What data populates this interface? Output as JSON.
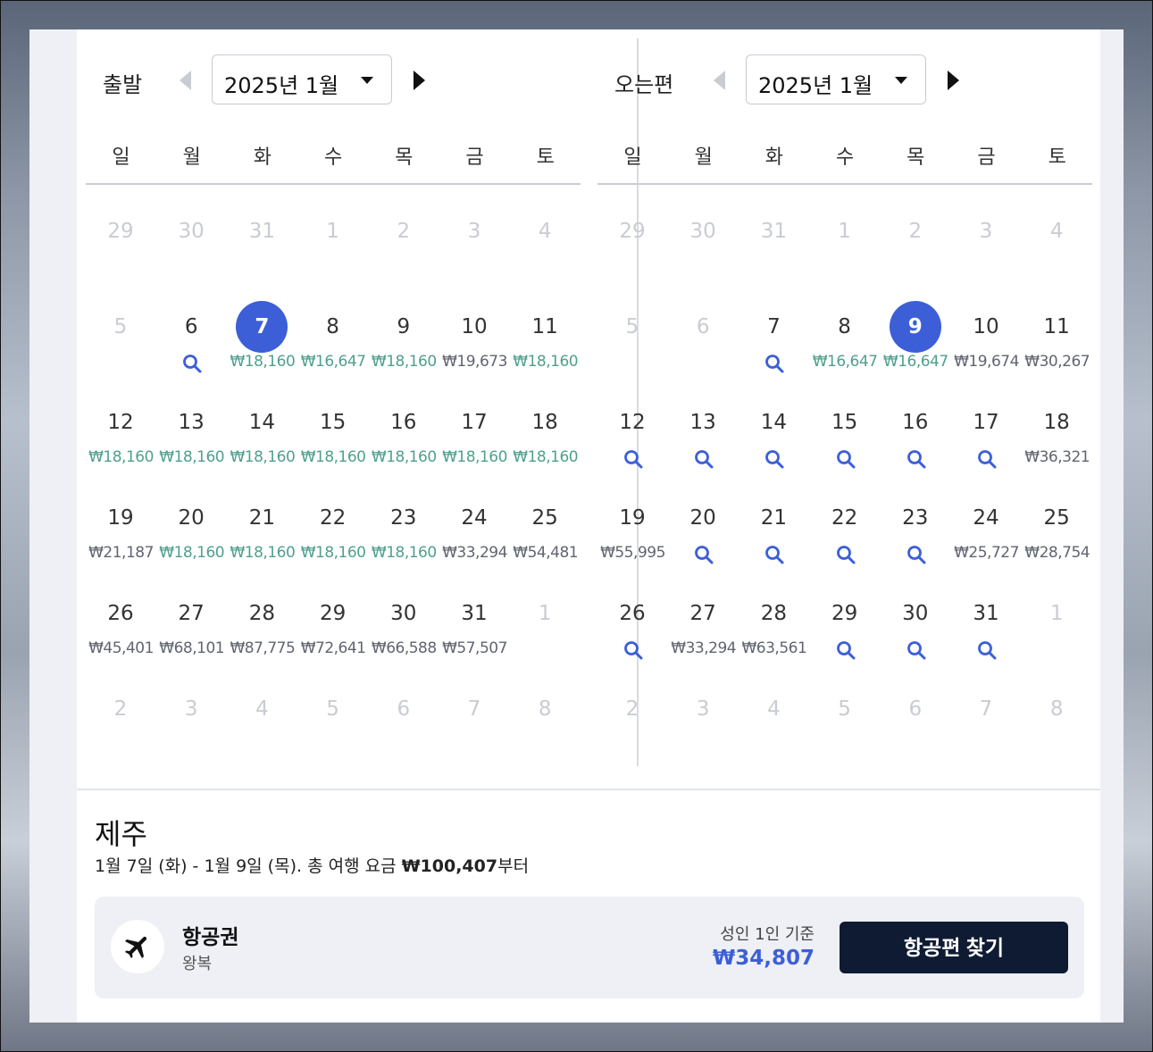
{
  "departure": {
    "label": "출발",
    "month": "2025년 1월",
    "weekdays": [
      "일",
      "월",
      "화",
      "수",
      "목",
      "금",
      "토"
    ],
    "days": [
      {
        "n": "29",
        "muted": true
      },
      {
        "n": "30",
        "muted": true
      },
      {
        "n": "31",
        "muted": true
      },
      {
        "n": "1",
        "muted": true
      },
      {
        "n": "2",
        "muted": true
      },
      {
        "n": "3",
        "muted": true
      },
      {
        "n": "4",
        "muted": true
      },
      {
        "n": "5",
        "muted": true
      },
      {
        "n": "6",
        "search": true
      },
      {
        "n": "7",
        "price": "₩18,160",
        "cheap": true,
        "selected": true
      },
      {
        "n": "8",
        "price": "₩16,647",
        "cheap": true
      },
      {
        "n": "9",
        "price": "₩18,160",
        "cheap": true
      },
      {
        "n": "10",
        "price": "₩19,673",
        "cheap": false
      },
      {
        "n": "11",
        "price": "₩18,160",
        "cheap": true
      },
      {
        "n": "12",
        "price": "₩18,160",
        "cheap": true
      },
      {
        "n": "13",
        "price": "₩18,160",
        "cheap": true
      },
      {
        "n": "14",
        "price": "₩18,160",
        "cheap": true
      },
      {
        "n": "15",
        "price": "₩18,160",
        "cheap": true
      },
      {
        "n": "16",
        "price": "₩18,160",
        "cheap": true
      },
      {
        "n": "17",
        "price": "₩18,160",
        "cheap": true
      },
      {
        "n": "18",
        "price": "₩18,160",
        "cheap": true
      },
      {
        "n": "19",
        "price": "₩21,187",
        "cheap": false
      },
      {
        "n": "20",
        "price": "₩18,160",
        "cheap": true
      },
      {
        "n": "21",
        "price": "₩18,160",
        "cheap": true
      },
      {
        "n": "22",
        "price": "₩18,160",
        "cheap": true
      },
      {
        "n": "23",
        "price": "₩18,160",
        "cheap": true
      },
      {
        "n": "24",
        "price": "₩33,294",
        "cheap": false
      },
      {
        "n": "25",
        "price": "₩54,481",
        "cheap": false
      },
      {
        "n": "26",
        "price": "₩45,401",
        "cheap": false
      },
      {
        "n": "27",
        "price": "₩68,101",
        "cheap": false
      },
      {
        "n": "28",
        "price": "₩87,775",
        "cheap": false
      },
      {
        "n": "29",
        "price": "₩72,641",
        "cheap": false
      },
      {
        "n": "30",
        "price": "₩66,588",
        "cheap": false
      },
      {
        "n": "31",
        "price": "₩57,507",
        "cheap": false
      },
      {
        "n": "1",
        "muted": true
      },
      {
        "n": "2",
        "muted": true
      },
      {
        "n": "3",
        "muted": true
      },
      {
        "n": "4",
        "muted": true
      },
      {
        "n": "5",
        "muted": true
      },
      {
        "n": "6",
        "muted": true
      },
      {
        "n": "7",
        "muted": true
      },
      {
        "n": "8",
        "muted": true
      }
    ]
  },
  "return": {
    "label": "오는편",
    "month": "2025년 1월",
    "weekdays": [
      "일",
      "월",
      "화",
      "수",
      "목",
      "금",
      "토"
    ],
    "days": [
      {
        "n": "29",
        "muted": true
      },
      {
        "n": "30",
        "muted": true
      },
      {
        "n": "31",
        "muted": true
      },
      {
        "n": "1",
        "muted": true
      },
      {
        "n": "2",
        "muted": true
      },
      {
        "n": "3",
        "muted": true
      },
      {
        "n": "4",
        "muted": true
      },
      {
        "n": "5",
        "muted": true
      },
      {
        "n": "6",
        "muted": true
      },
      {
        "n": "7",
        "search": true
      },
      {
        "n": "8",
        "price": "₩16,647",
        "cheap": true
      },
      {
        "n": "9",
        "price": "₩16,647",
        "cheap": true,
        "selected": true
      },
      {
        "n": "10",
        "price": "₩19,674",
        "cheap": false
      },
      {
        "n": "11",
        "price": "₩30,267",
        "cheap": false
      },
      {
        "n": "12",
        "search": true
      },
      {
        "n": "13",
        "search": true
      },
      {
        "n": "14",
        "search": true
      },
      {
        "n": "15",
        "search": true
      },
      {
        "n": "16",
        "search": true
      },
      {
        "n": "17",
        "search": true
      },
      {
        "n": "18",
        "price": "₩36,321",
        "cheap": false
      },
      {
        "n": "19",
        "price": "₩55,995",
        "cheap": false
      },
      {
        "n": "20",
        "search": true
      },
      {
        "n": "21",
        "search": true
      },
      {
        "n": "22",
        "search": true
      },
      {
        "n": "23",
        "search": true
      },
      {
        "n": "24",
        "price": "₩25,727",
        "cheap": false
      },
      {
        "n": "25",
        "price": "₩28,754",
        "cheap": false
      },
      {
        "n": "26",
        "search": true
      },
      {
        "n": "27",
        "price": "₩33,294",
        "cheap": false
      },
      {
        "n": "28",
        "price": "₩63,561",
        "cheap": false
      },
      {
        "n": "29",
        "search": true
      },
      {
        "n": "30",
        "search": true
      },
      {
        "n": "31",
        "search": true
      },
      {
        "n": "1",
        "muted": true
      },
      {
        "n": "2",
        "muted": true
      },
      {
        "n": "3",
        "muted": true
      },
      {
        "n": "4",
        "muted": true
      },
      {
        "n": "5",
        "muted": true
      },
      {
        "n": "6",
        "muted": true
      },
      {
        "n": "7",
        "muted": true
      },
      {
        "n": "8",
        "muted": true
      }
    ]
  },
  "summary": {
    "destination": "제주",
    "dates": "1월 7일 (화) - 1월 9일 (목).",
    "total_prefix": " 총 여행 요금 ",
    "total_price": "₩100,407",
    "total_suffix": "부터"
  },
  "flight_card": {
    "icon": "airplane-icon",
    "title": "항공권",
    "subtitle": "왕복",
    "basis": "성인 1인 기준",
    "price": "₩34,807",
    "button_label": "항공편 찾기"
  },
  "colors": {
    "accent": "#3c5fd8",
    "cheap_price": "#4fa08f",
    "button_bg": "#0f1b33"
  }
}
